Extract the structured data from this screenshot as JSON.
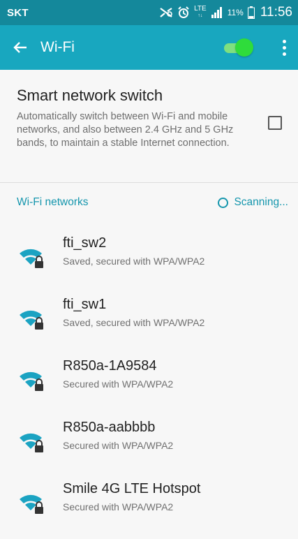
{
  "status_bar": {
    "carrier": "SKT",
    "network_type": "LTE",
    "battery": "11%",
    "time": "11:56"
  },
  "app_bar": {
    "title": "Wi-Fi",
    "wifi_enabled": true
  },
  "smart_network_switch": {
    "title": "Smart network switch",
    "description": "Automatically switch between Wi-Fi and mobile networks, and also between 2.4 GHz and 5 GHz bands, to maintain a stable Internet connection.",
    "checked": false
  },
  "networks_section": {
    "header": "Wi-Fi networks",
    "scan_status": "Scanning..."
  },
  "networks": [
    {
      "name": "fti_sw2",
      "status": "Saved, secured with WPA/WPA2"
    },
    {
      "name": "fti_sw1",
      "status": "Saved, secured with WPA/WPA2"
    },
    {
      "name": "R850a-1A9584",
      "status": "Secured with WPA/WPA2"
    },
    {
      "name": "R850a-aabbbb",
      "status": "Secured with WPA/WPA2"
    },
    {
      "name": "Smile 4G LTE Hotspot",
      "status": "Secured with WPA/WPA2"
    }
  ],
  "colors": {
    "status_bar": "#14889b",
    "app_bar": "#18a7bf",
    "accent": "#1596ad",
    "toggle_on": "#2fdc3b",
    "wifi_icon": "#1ba3c2"
  }
}
